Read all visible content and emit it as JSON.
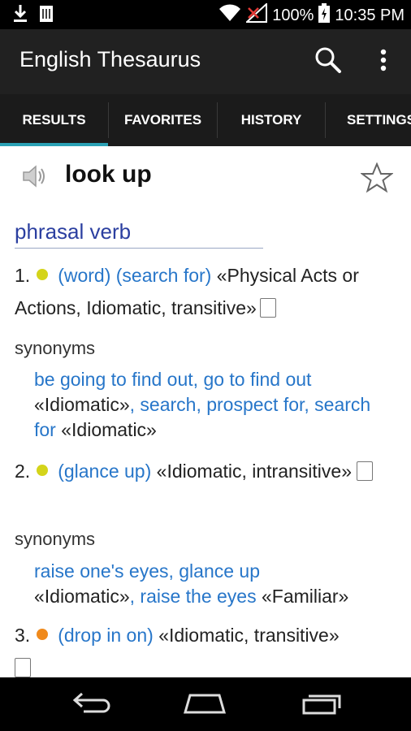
{
  "status": {
    "battery": "100%",
    "time": "10:35 PM"
  },
  "app": {
    "title": "English Thesaurus"
  },
  "tabs": [
    {
      "label": "RESULTS"
    },
    {
      "label": "FAVORITES"
    },
    {
      "label": "HISTORY"
    },
    {
      "label": "SETTINGS"
    }
  ],
  "entry": {
    "word": "look up",
    "part_of_speech": "phrasal verb",
    "senses": [
      {
        "number": "1.",
        "dot_color": "#d4d41a",
        "definition": "(word) (search for)",
        "tags": "«Physical Acts or Actions, Idiomatic, transitive»",
        "synonyms_label": "synonyms",
        "synonyms": [
          {
            "text": "be going to find out, go to find out",
            "tag": ""
          },
          {
            "text": "",
            "tag": "«Idiomatic»"
          },
          {
            "text": ", search, prospect for, search for",
            "tag": " «Idiomatic»"
          }
        ]
      },
      {
        "number": "2.",
        "dot_color": "#d4d41a",
        "definition": "(glance up)",
        "tags": "«Idiomatic, intransitive»",
        "synonyms_label": "synonyms",
        "synonyms": [
          {
            "text": "raise one's eyes, glance up",
            "tag": ""
          },
          {
            "text": "",
            "tag": "«Idiomatic»"
          },
          {
            "text": ", raise the eyes",
            "tag": " «Familiar»"
          }
        ]
      },
      {
        "number": "3.",
        "dot_color": "#f08a1c",
        "definition": "(drop in on)",
        "tags": "«Idiomatic, transitive»"
      }
    ]
  },
  "icons": {
    "download": "download-icon",
    "sim": "sim-icon",
    "wifi": "wifi-icon",
    "signal": "signal-icon",
    "battery": "battery-icon",
    "search": "search-icon",
    "menu": "overflow-menu-icon",
    "speaker": "speaker-icon",
    "star": "star-outline-icon",
    "note": "note-icon",
    "back": "back-icon",
    "home": "home-icon",
    "recents": "recents-icon"
  }
}
